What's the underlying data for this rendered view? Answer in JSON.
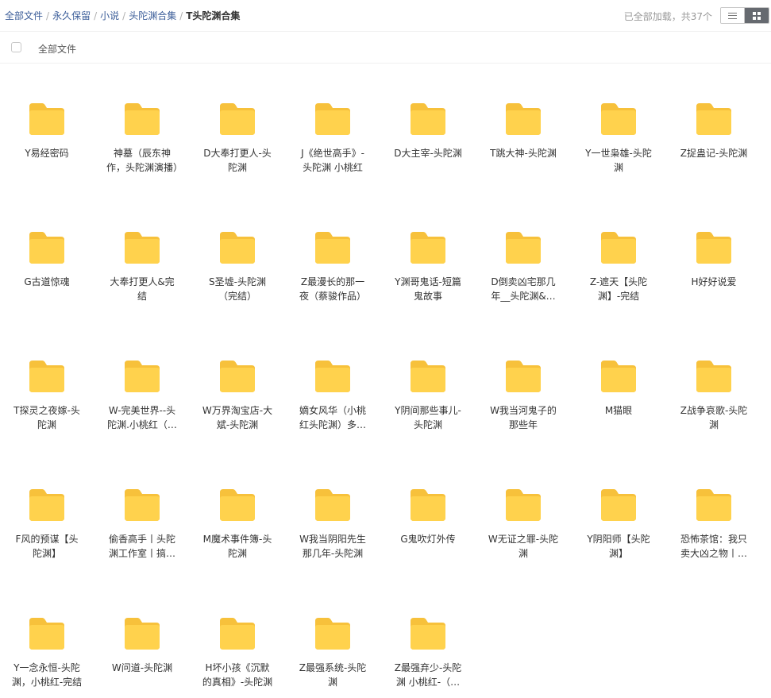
{
  "breadcrumb": {
    "items": [
      "全部文件",
      "永久保留",
      "小说",
      "头陀渊合集"
    ],
    "current": "T头陀渊合集",
    "separator": "/"
  },
  "status": {
    "loaded_text": "已全部加载，共37个"
  },
  "view_switch": {
    "list_icon": "list-icon",
    "grid_icon": "grid-icon",
    "active": "grid"
  },
  "header": {
    "select_all_label": "全部文件"
  },
  "colors": {
    "folder_body": "#FFD24D",
    "folder_tab": "#F7C13B",
    "link": "#3b5d99",
    "active_view": "#666a70"
  },
  "files": [
    {
      "name": "Y易经密码"
    },
    {
      "name": "神墓（辰东神作，头陀渊演播）"
    },
    {
      "name": "D大奉打更人-头陀渊"
    },
    {
      "name": "J《绝世高手》-头陀渊 小桃红"
    },
    {
      "name": "D大主宰-头陀渊"
    },
    {
      "name": "T跳大神-头陀渊"
    },
    {
      "name": "Y一世枭雄-头陀渊"
    },
    {
      "name": "Z捉蛊记-头陀渊"
    },
    {
      "name": "G古道惊魂"
    },
    {
      "name": "大奉打更人&完结"
    },
    {
      "name": "S圣墟-头陀渊（完结）"
    },
    {
      "name": "Z最漫长的那一夜（蔡骏作品）"
    },
    {
      "name": "Y渊哥鬼话-短篇鬼故事"
    },
    {
      "name": "D倒卖凶宅那几年__头陀渊&小桃红"
    },
    {
      "name": "Z-遮天【头陀渊】-完结"
    },
    {
      "name": "H好好说爱"
    },
    {
      "name": "T探灵之夜嫁-头陀渊"
    },
    {
      "name": "W-完美世界--头陀渊.小桃红（完结）"
    },
    {
      "name": "W万界淘宝店-大斌-头陀渊"
    },
    {
      "name": "嫡女风华（小桃红头陀渊）多人有声剧"
    },
    {
      "name": "Y阴间那些事儿-头陀渊"
    },
    {
      "name": "W我当河鬼子的那些年"
    },
    {
      "name": "M猫眼"
    },
    {
      "name": "Z战争哀歌-头陀渊"
    },
    {
      "name": "F风的预谋【头陀渊】"
    },
    {
      "name": "偷香高手丨头陀渊工作室丨搞笑都市"
    },
    {
      "name": "M魔术事件簿-头陀渊"
    },
    {
      "name": "W我当阴阳先生那几年-头陀渊"
    },
    {
      "name": "G鬼吹灯外传"
    },
    {
      "name": "W无证之罪-头陀渊"
    },
    {
      "name": "Y阴阳师【头陀渊】"
    },
    {
      "name": "恐怖茶馆：我只卖大凶之物丨头陀渊"
    },
    {
      "name": "Y一念永恒-头陀渊，小桃红-完结"
    },
    {
      "name": "W问道-头陀渊"
    },
    {
      "name": "H坏小孩《沉默的真相》-头陀渊"
    },
    {
      "name": "Z最强系统-头陀渊"
    },
    {
      "name": "Z最强弃少-头陀渊 小桃红-（完结）"
    }
  ]
}
